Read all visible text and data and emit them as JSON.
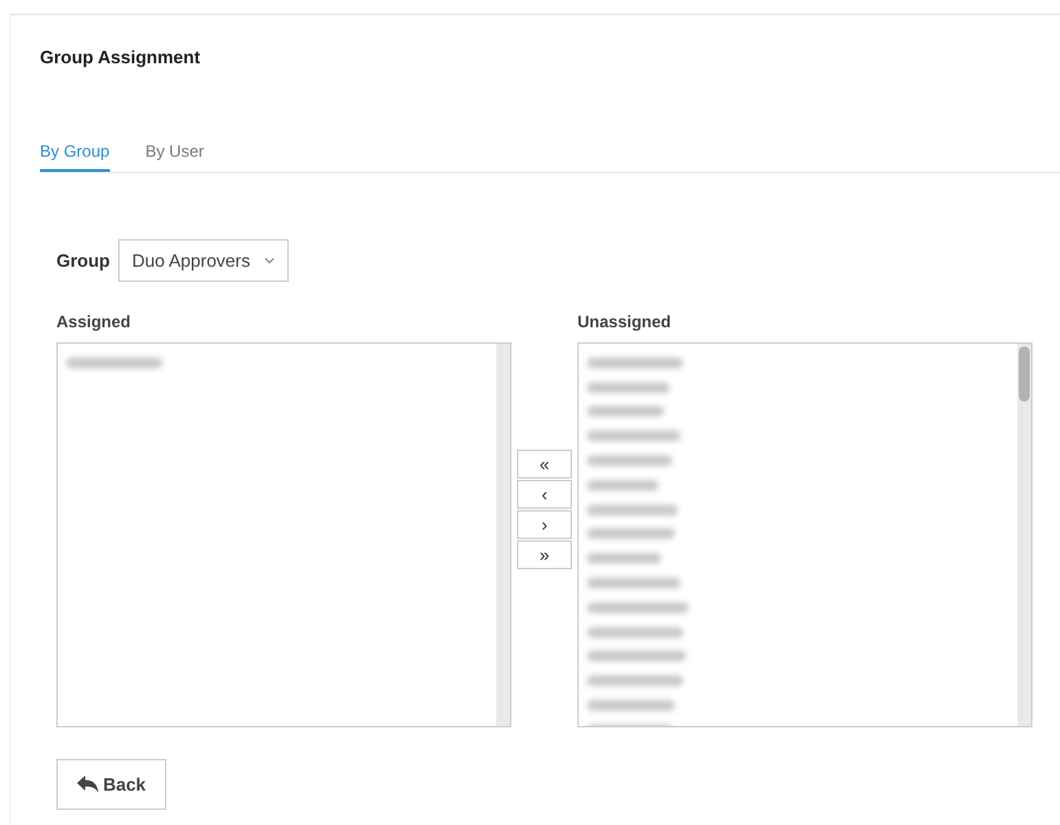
{
  "panel": {
    "title": "Group Assignment"
  },
  "tabs": [
    {
      "label": "By Group",
      "selected": true
    },
    {
      "label": "By User",
      "selected": false
    }
  ],
  "group_filter": {
    "label": "Group",
    "value": "Duo Approvers"
  },
  "assigned": {
    "label": "Assigned",
    "items": [
      {
        "kind": "redacted"
      }
    ]
  },
  "transfer_buttons": [
    "«",
    "‹",
    "›",
    "»"
  ],
  "unassigned": {
    "label": "Unassigned",
    "items": [
      {
        "kind": "redacted"
      },
      {
        "kind": "redacted"
      },
      {
        "kind": "redacted"
      },
      {
        "kind": "redacted"
      },
      {
        "kind": "redacted"
      },
      {
        "kind": "redacted"
      },
      {
        "kind": "redacted"
      },
      {
        "kind": "redacted"
      },
      {
        "kind": "redacted"
      },
      {
        "kind": "redacted"
      },
      {
        "kind": "redacted"
      },
      {
        "kind": "redacted"
      },
      {
        "kind": "redacted"
      },
      {
        "kind": "redacted"
      },
      {
        "kind": "redacted"
      },
      {
        "kind": "redacted"
      }
    ]
  },
  "back_button": {
    "label": "Back"
  }
}
